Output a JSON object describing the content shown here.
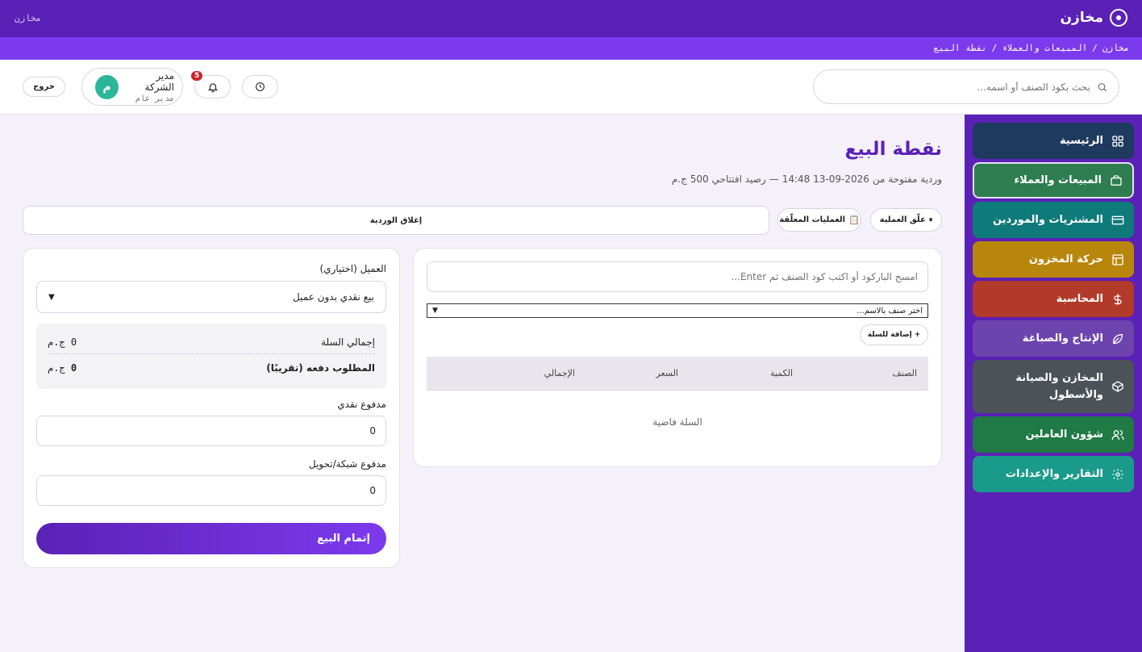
{
  "app": {
    "name": "مخازن",
    "topbar_left": "مخازن"
  },
  "breadcrumb": [
    "مخازن",
    "/",
    "المبيعات والعملاء",
    "/",
    "نقطة البيع"
  ],
  "header": {
    "search_placeholder": "بحث بكود الصنف أو اسمه...",
    "user": {
      "name": "مدير الشركة",
      "role": "مدير عام",
      "avatar_letter": "م"
    },
    "notifications_count": "5",
    "logout_label": "خروج"
  },
  "sidebar": {
    "items": [
      {
        "label": "الرئيسية",
        "color": "#1f3a5f",
        "icon": "grid-icon"
      },
      {
        "label": "المبيعات والعملاء",
        "color": "#2e7d4f",
        "icon": "bag-icon",
        "active": true
      },
      {
        "label": "المشتريات والموردين",
        "color": "#0f7a7a",
        "icon": "card-icon"
      },
      {
        "label": "حركة المخزون",
        "color": "#b8860b",
        "icon": "layout-icon"
      },
      {
        "label": "المحاسبة",
        "color": "#b23a2b",
        "icon": "dollar-icon"
      },
      {
        "label": "الإنتاج والصباغة",
        "color": "#6d44ad",
        "icon": "leaf-icon"
      },
      {
        "label": "المخازن والصيانة والأسطول",
        "color": "#4b5258",
        "icon": "box-icon"
      },
      {
        "label": "شؤون العاملين",
        "color": "#1f7a45",
        "icon": "users-icon"
      },
      {
        "label": "التقارير والإعدادات",
        "color": "#1a9a8a",
        "icon": "gear-icon"
      }
    ]
  },
  "page": {
    "title": "نقطة البيع",
    "shift_prefix": "وردية مفتوحة من",
    "shift_datetime": "2026-09-13 14:48",
    "shift_dash": "—",
    "opening_balance_label": "رصيد افتتاحي",
    "opening_balance_value": "500 ج.م"
  },
  "actions": {
    "suspend_label": "علّق العملية",
    "held_label": "العمليات المعلّقة",
    "close_shift_label": "إغلاق الوردية"
  },
  "cart": {
    "barcode_placeholder": "امسح الباركود أو اكتب كود الصنف ثم Enter...",
    "select_placeholder": "اختر صنف بالاسم...",
    "add_button": "إضافة للسلة",
    "columns": [
      "الصنف",
      "الكمية",
      "السعر",
      "الإجمالي"
    ],
    "empty_text": "السلة فاضية"
  },
  "payment": {
    "customer_label": "العميل (اختياري)",
    "customer_value": "بيع نقدي بدون عميل",
    "cart_total_label": "إجمالي السلة",
    "cart_total_value": "0",
    "due_label": "المطلوب دفعه (تقريبًا)",
    "due_value": "0",
    "currency": "ج.م",
    "cash_label": "مدفوع نقدي",
    "cash_value": "0",
    "card_label": "مدفوع شبكة/تحويل",
    "card_value": "0",
    "complete_label": "إتمام البيع"
  }
}
